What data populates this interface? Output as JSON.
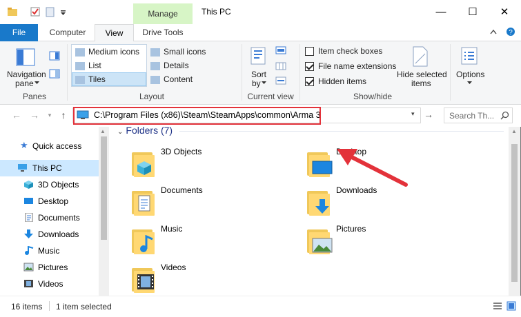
{
  "window": {
    "title": "This PC",
    "context_tab": "Manage",
    "minimize": "—",
    "maximize": "☐",
    "close": "✕"
  },
  "ribbon_tabs": [
    "File",
    "Computer",
    "View",
    "Drive Tools"
  ],
  "ribbon": {
    "panes": {
      "navigation_pane": "Navigation",
      "navigation_pane_2": "pane",
      "group_label": "Panes"
    },
    "layout": {
      "items": [
        "Medium icons",
        "List",
        "Tiles",
        "Small icons",
        "Details",
        "Content"
      ],
      "selected": "Tiles",
      "group_label": "Layout"
    },
    "current_view": {
      "sort_by": "Sort",
      "sort_by_2": "by",
      "group_label": "Current view"
    },
    "show_hide": {
      "item_check_boxes": {
        "label": "Item check boxes",
        "checked": false
      },
      "file_name_extensions": {
        "label": "File name extensions",
        "checked": true
      },
      "hidden_items": {
        "label": "Hidden items",
        "checked": true
      },
      "hide_selected": "Hide selected",
      "hide_selected_2": "items",
      "group_label": "Show/hide"
    },
    "options": "Options"
  },
  "address": {
    "path": "C:\\Program Files (x86)\\Steam\\SteamApps\\common\\Arma 3",
    "search_placeholder": "Search Th..."
  },
  "nav_pane": {
    "items": [
      {
        "label": "Quick access",
        "icon": "star-icon"
      },
      {
        "label": "This PC",
        "icon": "computer-icon",
        "selected": true
      },
      {
        "label": "3D Objects",
        "icon": "cube-icon"
      },
      {
        "label": "Desktop",
        "icon": "desktop-icon"
      },
      {
        "label": "Documents",
        "icon": "documents-icon"
      },
      {
        "label": "Downloads",
        "icon": "downloads-icon"
      },
      {
        "label": "Music",
        "icon": "music-icon"
      },
      {
        "label": "Pictures",
        "icon": "pictures-icon"
      },
      {
        "label": "Videos",
        "icon": "videos-icon"
      }
    ]
  },
  "content": {
    "group_header": "Folders (7)",
    "folders": [
      {
        "label": "3D Objects",
        "icon": "3d-objects-folder-icon"
      },
      {
        "label": "Desktop",
        "icon": "desktop-folder-icon"
      },
      {
        "label": "Documents",
        "icon": "documents-folder-icon"
      },
      {
        "label": "Downloads",
        "icon": "downloads-folder-icon"
      },
      {
        "label": "Music",
        "icon": "music-folder-icon"
      },
      {
        "label": "Pictures",
        "icon": "pictures-folder-icon"
      },
      {
        "label": "Videos",
        "icon": "videos-folder-icon"
      }
    ]
  },
  "status": {
    "item_count": "16 items",
    "selection": "1 item selected"
  },
  "colors": {
    "file_tab": "#1979ca",
    "manage_tab": "#d7f5c6",
    "selection": "#cce8ff",
    "annotation_red": "#e3323a",
    "folder_header": "#1e3287"
  }
}
